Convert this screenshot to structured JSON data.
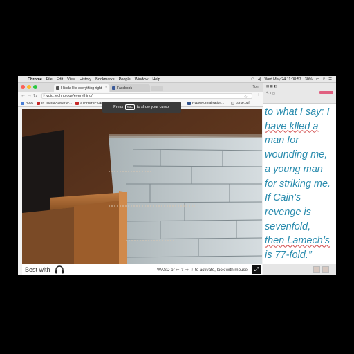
{
  "menubar": {
    "app": "Chrome",
    "items": [
      "File",
      "Edit",
      "View",
      "History",
      "Bookmarks",
      "People",
      "Window",
      "Help"
    ],
    "clock": "Wed May 24 11:08:57",
    "battery": "30%"
  },
  "tabs": [
    {
      "title": "I kinda like everything right",
      "active": true
    },
    {
      "title": "Facebook",
      "active": false
    }
  ],
  "profile_label": "Tom",
  "address": {
    "url": "void.technology/everything/"
  },
  "bookmarks": [
    {
      "label": "Apps",
      "color": "#4a7fd6"
    },
    {
      "label": "IF Trump At Mar-a-...",
      "color": "#c62828"
    },
    {
      "label": "STARSHIP GEN...",
      "color": "#c62828"
    },
    {
      "label": "HyperNormalisation...",
      "color": "#2c4f8a"
    },
    {
      "label": "curse.pdf",
      "color": "#e0e0e0"
    }
  ],
  "toast": {
    "before": "Press",
    "key": "esc",
    "after": "to show your cursor"
  },
  "infobar": {
    "best_with": "Best with",
    "hint": "WASD or ⇦ ⇧ ⇨ ⇩ to activate, look with mouse"
  },
  "document": {
    "lines": [
      "to what I say: I",
      "have klled a",
      "man for",
      "wounding me,",
      "a young man",
      "for striking me.",
      "If Cain’s",
      "revenge is",
      "sevenfold,",
      "then Lamech’s",
      "is 77-fold.”"
    ],
    "text_color": "#2a8cae"
  },
  "colors": {
    "light_red": "#fc5f57",
    "light_yellow": "#fdbc2e",
    "light_green": "#28c840"
  }
}
